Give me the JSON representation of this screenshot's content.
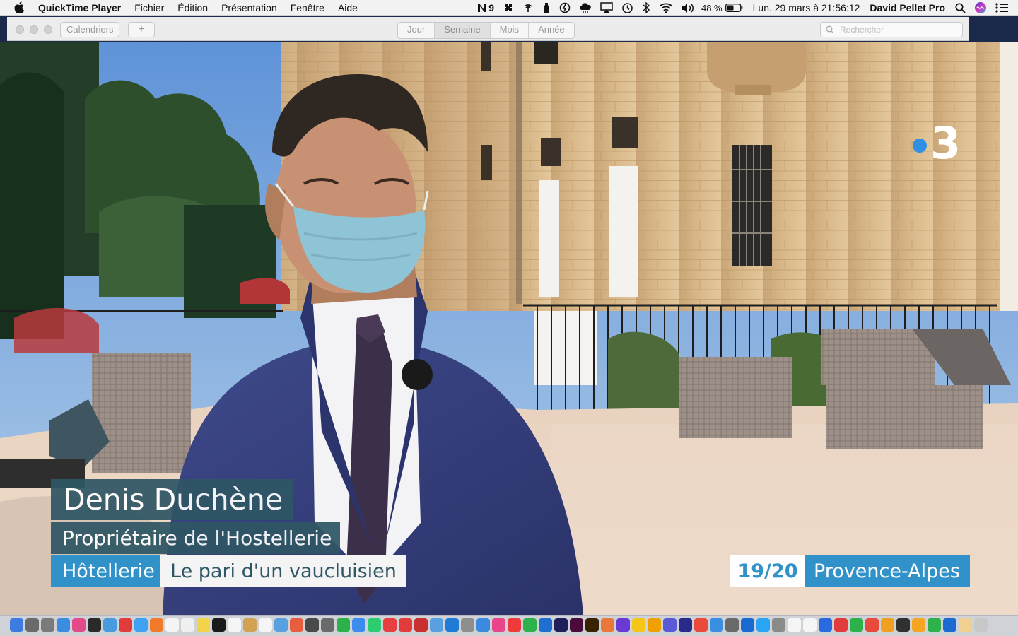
{
  "menubar": {
    "app_name": "QuickTime Player",
    "menus": [
      "Fichier",
      "Édition",
      "Présentation",
      "Fenêtre",
      "Aide"
    ],
    "status": {
      "notification_count": "9",
      "battery": "48 %",
      "datetime": "Lun. 29 mars à  21:56:12",
      "user": "David Pellet Pro"
    }
  },
  "calendar_toolbar": {
    "calendars_label": "Calendriers",
    "add_label": "+",
    "views": [
      "Jour",
      "Semaine",
      "Mois",
      "Année"
    ],
    "selected_view": "Semaine",
    "search_placeholder": "Rechercher"
  },
  "broadcast": {
    "channel_logo_number": "3",
    "person_name": "Denis Duchène",
    "person_role": "Propriétaire de l'Hostellerie",
    "topic_tag": "Hôtellerie",
    "topic_title": "Le pari d'un vaucluisien",
    "edition": "19/20",
    "region": "Provence-Alpes",
    "colors": {
      "dark_band": "#2f5665",
      "blue_band": "#3192c9"
    }
  },
  "dock": {
    "colors": [
      "#3d7be0",
      "#6a6a6a",
      "#7a7a7a",
      "#3a8de0",
      "#e24a8a",
      "#2a2a2a",
      "#4a9ae0",
      "#e23b3b",
      "#3fa2f0",
      "#f07a2a",
      "#f4f4f4",
      "#f0f0f0",
      "#f3d34a",
      "#1a1a1a",
      "#f5f5f5",
      "#d2a254",
      "#f5f5f5",
      "#58a0e0",
      "#e85d3d",
      "#4a4a4a",
      "#6a6a6a",
      "#2db14a",
      "#3c8cf0",
      "#2ecc71",
      "#e84040",
      "#e23b3b",
      "#c93030",
      "#5aa0e0",
      "#1f7bd6",
      "#8e8e8e",
      "#3a8ae0",
      "#e8458a",
      "#ee3a3a",
      "#2db14a",
      "#1f6fd0",
      "#1f1f5a",
      "#4a0a3a",
      "#3a2300",
      "#e8793a",
      "#6a3bd2",
      "#f5c518",
      "#f0a000",
      "#5a5ad6",
      "#2a2a8a",
      "#e84b3b",
      "#3b8fe0",
      "#6a6a6a",
      "#1b6ad1",
      "#2aa4f4",
      "#8a8a8a",
      "#f5f5f5",
      "#f5f5f5",
      "#2a6ae0",
      "#e23b3b",
      "#2db14a",
      "#e84b3b",
      "#f0a020",
      "#303030",
      "#f5a524",
      "#2db14a",
      "#1b6ad1",
      "#f0d090",
      "#c8c8c8"
    ]
  }
}
